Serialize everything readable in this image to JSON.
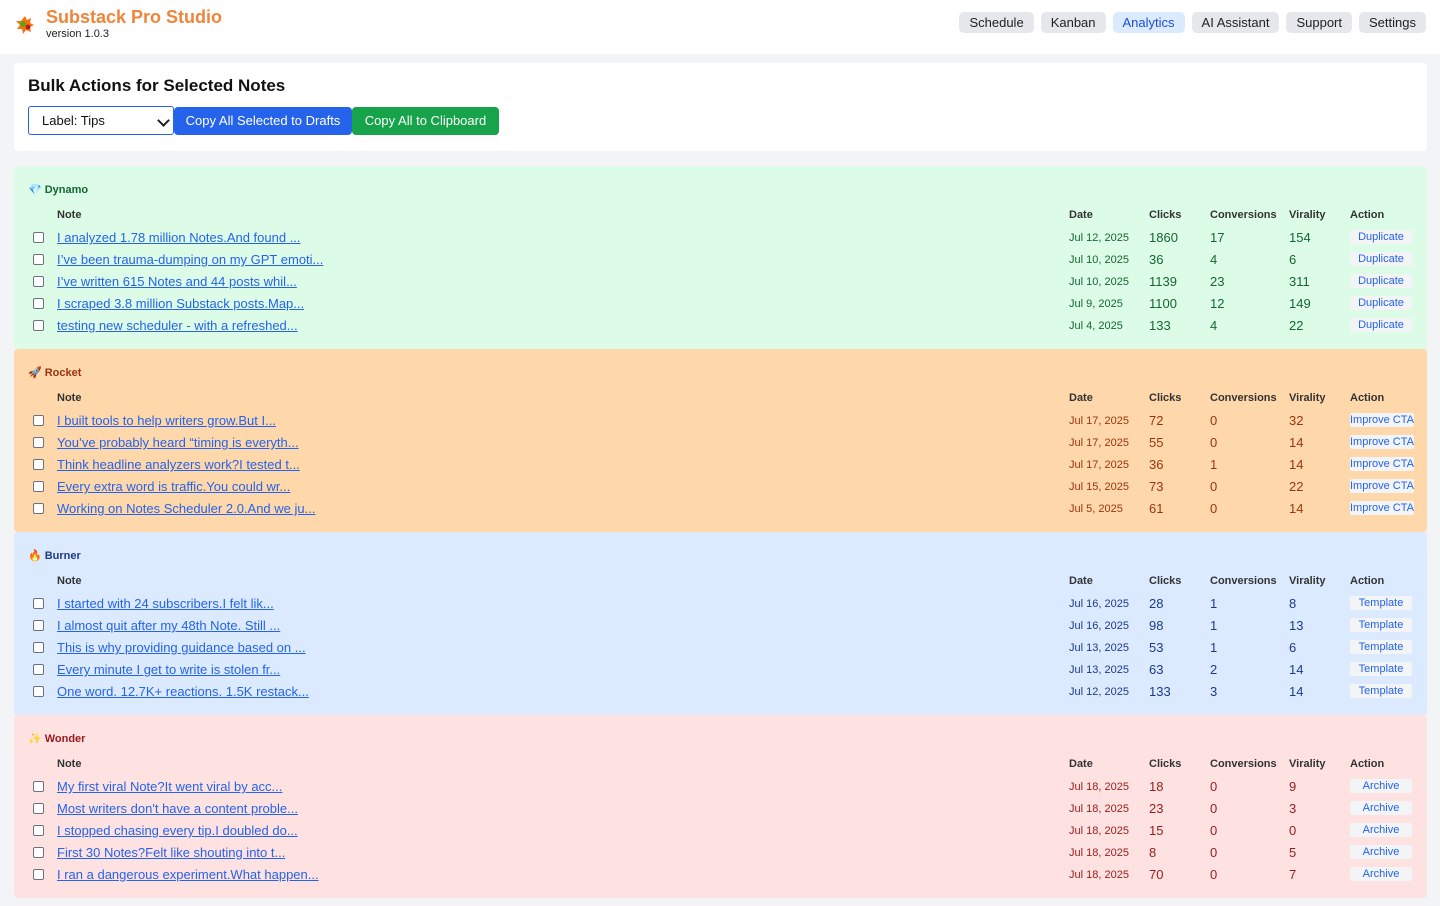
{
  "header": {
    "title": "Substack Pro Studio",
    "version": "version 1.0.3",
    "nav": [
      "Schedule",
      "Kanban",
      "Analytics",
      "AI Assistant",
      "Support",
      "Settings"
    ],
    "active_nav": "Analytics"
  },
  "bulk": {
    "heading": "Bulk Actions for Selected Notes",
    "label_select": "Label: Tips",
    "copy_drafts": "Copy All Selected to Drafts",
    "copy_clipboard": "Copy All to Clipboard"
  },
  "columns": {
    "note": "Note",
    "date": "Date",
    "clicks": "Clicks",
    "conversions": "Conversions",
    "virality": "Virality",
    "action": "Action"
  },
  "groups": [
    {
      "emoji": "💎",
      "name": "Dynamo",
      "bg": "#dcfce7",
      "fg": "#166534",
      "action": "Duplicate",
      "rows": [
        {
          "note": "I analyzed 1.78 million Notes.And found ...",
          "date": "Jul 12, 2025",
          "clicks": "1860",
          "conversions": "17",
          "virality": "154"
        },
        {
          "note": "I’ve been trauma-dumping on my GPT emoti...",
          "date": "Jul 10, 2025",
          "clicks": "36",
          "conversions": "4",
          "virality": "6"
        },
        {
          "note": "I’ve written 615 Notes and 44 posts whil...",
          "date": "Jul 10, 2025",
          "clicks": "1139",
          "conversions": "23",
          "virality": "311"
        },
        {
          "note": "I scraped 3.8 million Substack posts.Map...",
          "date": "Jul 9, 2025",
          "clicks": "1100",
          "conversions": "12",
          "virality": "149"
        },
        {
          "note": "testing new scheduler - with a refreshed...",
          "date": "Jul 4, 2025",
          "clicks": "133",
          "conversions": "4",
          "virality": "22"
        }
      ]
    },
    {
      "emoji": "🚀",
      "name": "Rocket",
      "bg": "#fed7aa",
      "fg": "#9a3412",
      "action": "Improve CTA",
      "rows": [
        {
          "note": "I built tools to help writers grow.But I...",
          "date": "Jul 17, 2025",
          "clicks": "72",
          "conversions": "0",
          "virality": "32"
        },
        {
          "note": "You’ve probably heard “timing is everyth...",
          "date": "Jul 17, 2025",
          "clicks": "55",
          "conversions": "0",
          "virality": "14"
        },
        {
          "note": "Think headline analyzers work?I tested t...",
          "date": "Jul 17, 2025",
          "clicks": "36",
          "conversions": "1",
          "virality": "14"
        },
        {
          "note": "Every extra word is traffic.You could wr...",
          "date": "Jul 15, 2025",
          "clicks": "73",
          "conversions": "0",
          "virality": "22"
        },
        {
          "note": "Working on Notes Scheduler 2.0.And we ju...",
          "date": "Jul 5, 2025",
          "clicks": "61",
          "conversions": "0",
          "virality": "14"
        }
      ]
    },
    {
      "emoji": "🔥",
      "name": "Burner",
      "bg": "#dbeafe",
      "fg": "#1e3a8a",
      "action": "Template",
      "rows": [
        {
          "note": "I started with 24 subscribers.I felt lik...",
          "date": "Jul 16, 2025",
          "clicks": "28",
          "conversions": "1",
          "virality": "8"
        },
        {
          "note": "I almost quit after my 48th Note. Still ...",
          "date": "Jul 16, 2025",
          "clicks": "98",
          "conversions": "1",
          "virality": "13"
        },
        {
          "note": "This is why providing guidance based on ...",
          "date": "Jul 13, 2025",
          "clicks": "53",
          "conversions": "1",
          "virality": "6"
        },
        {
          "note": "Every minute I get to write is stolen fr...",
          "date": "Jul 13, 2025",
          "clicks": "63",
          "conversions": "2",
          "virality": "14"
        },
        {
          "note": "One word. 12.7K+ reactions. 1.5K restack...",
          "date": "Jul 12, 2025",
          "clicks": "133",
          "conversions": "3",
          "virality": "14"
        }
      ]
    },
    {
      "emoji": "✨",
      "name": "Wonder",
      "bg": "#fee2e2",
      "fg": "#991b1b",
      "action": "Archive",
      "rows": [
        {
          "note": "My first viral Note?It went viral by acc...",
          "date": "Jul 18, 2025",
          "clicks": "18",
          "conversions": "0",
          "virality": "9"
        },
        {
          "note": "Most writers don't have a content proble...",
          "date": "Jul 18, 2025",
          "clicks": "23",
          "conversions": "0",
          "virality": "3"
        },
        {
          "note": "I stopped chasing every tip.I doubled do...",
          "date": "Jul 18, 2025",
          "clicks": "15",
          "conversions": "0",
          "virality": "0"
        },
        {
          "note": "First 30 Notes?Felt like shouting into t...",
          "date": "Jul 18, 2025",
          "clicks": "8",
          "conversions": "0",
          "virality": "5"
        },
        {
          "note": "I ran a dangerous experiment.What happen...",
          "date": "Jul 18, 2025",
          "clicks": "70",
          "conversions": "0",
          "virality": "7"
        }
      ]
    }
  ]
}
